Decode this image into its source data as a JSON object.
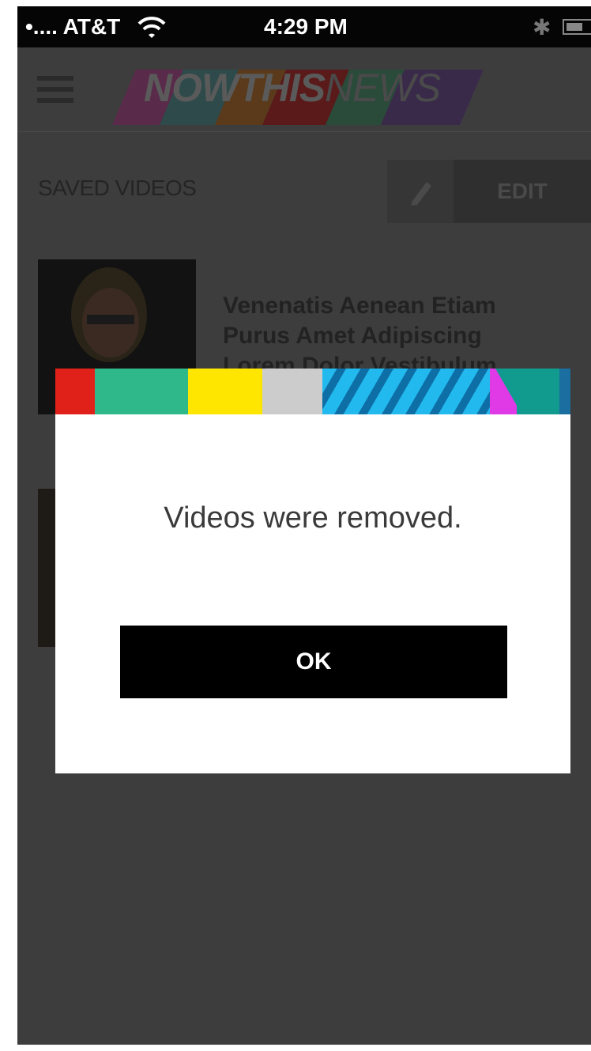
{
  "status_bar": {
    "carrier": "•.... AT&T",
    "time": "4:29 PM"
  },
  "header": {
    "logo_bold": "NOWTHIS",
    "logo_thin": "NEWS"
  },
  "section": {
    "title": "SAVED VIDEOS",
    "edit_label": "EDIT"
  },
  "videos": [
    {
      "title": "Venenatis Aenean Etiam Purus Amet Adipiscing Lorem Dolor Vestibulum"
    }
  ],
  "dialog": {
    "message": "Videos were removed.",
    "ok_label": "OK",
    "stripe_colors": [
      "#e0211a",
      "#2fb88a",
      "#ffe600",
      "#cccccc",
      "#22b9ee",
      "#e03ae6",
      "#119a8e",
      "#1a6fa0"
    ]
  },
  "icons": [
    "wifi-icon",
    "bluetooth-icon",
    "battery-icon",
    "hamburger-icon",
    "pencil-icon"
  ]
}
